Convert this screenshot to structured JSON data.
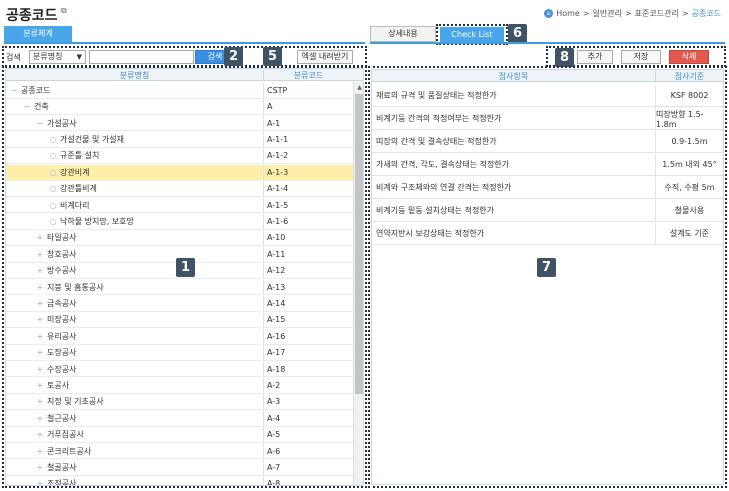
{
  "page": {
    "title": "공종코드",
    "ext_icon": "external-link-icon"
  },
  "breadcrumb": {
    "home": "Home",
    "sep": ">",
    "items": [
      "일반관리",
      "표준코드관리"
    ],
    "current": "공종코드"
  },
  "left": {
    "tab": "분류체계",
    "search_label": "검색",
    "search_select": "분류명칭",
    "search_value": "",
    "search_button": "검색",
    "excel_button": "엑셀 내려받기",
    "col_name": "분류명칭",
    "col_code": "분류코드",
    "rows": [
      {
        "name": "공종코드",
        "code": "CSTP",
        "level": 0,
        "icon": "−"
      },
      {
        "name": "건축",
        "code": "A",
        "level": 1,
        "icon": "−"
      },
      {
        "name": "가설공사",
        "code": "A-1",
        "level": 2,
        "icon": "−"
      },
      {
        "name": "가설건물 및 가설재",
        "code": "A-1-1",
        "level": 3,
        "icon": "○"
      },
      {
        "name": "규준틀 설치",
        "code": "A-1-2",
        "level": 3,
        "icon": "○"
      },
      {
        "name": "강관비계",
        "code": "A-1-3",
        "level": 3,
        "icon": "○"
      },
      {
        "name": "강관틀비계",
        "code": "A-1-4",
        "level": 3,
        "icon": "○"
      },
      {
        "name": "비계다리",
        "code": "A-1-5",
        "level": 3,
        "icon": "○"
      },
      {
        "name": "낙하물 방지망, 보호망",
        "code": "A-1-6",
        "level": 3,
        "icon": "○"
      },
      {
        "name": "타일공사",
        "code": "A-10",
        "level": 2,
        "icon": "+"
      },
      {
        "name": "창호공사",
        "code": "A-11",
        "level": 2,
        "icon": "+"
      },
      {
        "name": "방수공사",
        "code": "A-12",
        "level": 2,
        "icon": "+"
      },
      {
        "name": "지붕 및 홈통공사",
        "code": "A-13",
        "level": 2,
        "icon": "+"
      },
      {
        "name": "금속공사",
        "code": "A-14",
        "level": 2,
        "icon": "+"
      },
      {
        "name": "미장공사",
        "code": "A-15",
        "level": 2,
        "icon": "+"
      },
      {
        "name": "유리공사",
        "code": "A-16",
        "level": 2,
        "icon": "+"
      },
      {
        "name": "도장공사",
        "code": "A-17",
        "level": 2,
        "icon": "+"
      },
      {
        "name": "수장공사",
        "code": "A-18",
        "level": 2,
        "icon": "+"
      },
      {
        "name": "토공사",
        "code": "A-2",
        "level": 2,
        "icon": "+"
      },
      {
        "name": "지정 및 기초공사",
        "code": "A-3",
        "level": 2,
        "icon": "+"
      },
      {
        "name": "철근공사",
        "code": "A-4",
        "level": 2,
        "icon": "+"
      },
      {
        "name": "거푸집공사",
        "code": "A-5",
        "level": 2,
        "icon": "+"
      },
      {
        "name": "콘크리트공사",
        "code": "A-6",
        "level": 2,
        "icon": "+"
      },
      {
        "name": "철골공사",
        "code": "A-7",
        "level": 2,
        "icon": "+"
      },
      {
        "name": "조적공사",
        "code": "A-8",
        "level": 2,
        "icon": "+"
      }
    ],
    "selected_index": 5
  },
  "right": {
    "tab_detail": "상세내용",
    "tab_checklist": "Check List",
    "add_button": "추가",
    "save_button": "저장",
    "delete_button": "삭제",
    "col_item": "점사항목",
    "col_std": "점사기준",
    "rows": [
      {
        "item": "재료의 규격 및 품질상태는 적정한가",
        "std": "KSF 8002"
      },
      {
        "item": "비계기둥 간격의 적정여부는 적정한가",
        "std": "띠장방향 1.5-1.8m"
      },
      {
        "item": "띠장의 간격 및 결속상태는 적정한가",
        "std": "0.9-1.5m"
      },
      {
        "item": "가새의 간격, 각도, 결속상태는 적정한가",
        "std": "1.5m 내외 45°"
      },
      {
        "item": "비계와 구조체와의 연결 간격는 적정한가",
        "std": "수직, 수평 5m"
      },
      {
        "item": "비계기둥 밑둥 설치상태는 적정한가",
        "std": "철물사용"
      },
      {
        "item": "연약지반시 보강상태는 적정한가",
        "std": "설계도 기준"
      }
    ]
  },
  "annotations": {
    "b1": "1",
    "b2": "2",
    "b5": "5",
    "b6": "6",
    "b7": "7",
    "b8": "8"
  },
  "colors": {
    "accent": "#49a6ea",
    "badge": "#3f5266",
    "selected_row": "#fdeeaa",
    "delete": "#e25a4e"
  }
}
